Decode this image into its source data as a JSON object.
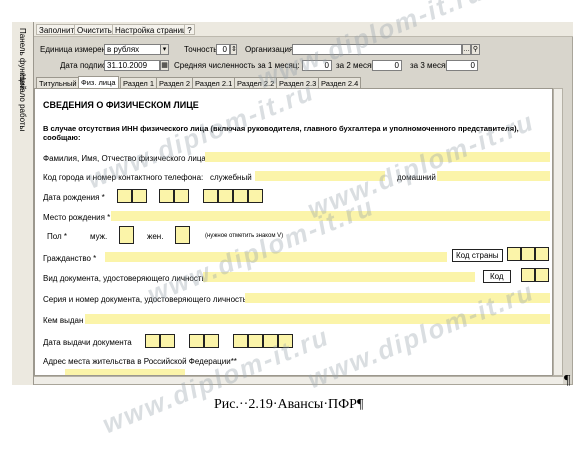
{
  "vertical_tabs": [
    "Панель функций",
    "Начало работы"
  ],
  "toolbar": {
    "fill_label": "Заполнить",
    "clear_label": "Очистить",
    "page_setup_label": "Настройка страниц",
    "help_label": "?"
  },
  "params": {
    "unit_label": "Единица измерения:",
    "unit_value": "в рублях",
    "precision_label": "Точность:",
    "precision_value": "0",
    "org_label": "Организация:",
    "org_value": "",
    "date_label": "Дата подписи:",
    "date_value": "31.10.2009",
    "headcount_label": "Средняя численность за 1 месяц:",
    "m1_value": "0",
    "m2_label": "за 2 месяц:",
    "m2_value": "0",
    "m3_label": "за 3 месяц:",
    "m3_value": "0"
  },
  "tabs": [
    "Титульный",
    "Физ. лица",
    "Раздел 1",
    "Раздел 2",
    "Раздел 2.1",
    "Раздел 2.2",
    "Раздел 2.3",
    "Раздел 2.4"
  ],
  "active_tab": "Физ. лица",
  "form": {
    "title": "СВЕДЕНИЯ О ФИЗИЧЕСКОМ ЛИЦЕ",
    "intro_line1": "В случае отсутствия ИНН физического лица (включая руководителя, главного бухгалтера и уполномоченного представителя),",
    "intro_line2": "сообщаю:",
    "fio": "Фамилия, Имя, Отчество физического лица",
    "phone": "Код города и номер контактного телефона:",
    "phone_work": "служебный",
    "phone_home": "домашний",
    "birth_date": "Дата рождения *",
    "birth_place": "Место рождения *",
    "sex": "Пол *",
    "male": "муж.",
    "female": "жен.",
    "sex_note": "(нужное отметить знаком V)",
    "citizenship": "Гражданство *",
    "country_code": "Код страны",
    "doc_type": "Вид документа, удостоверяющего личность",
    "code": "Код",
    "doc_number": "Серия и номер документа, удостоверяющего личность",
    "issued_by": "Кем выдан",
    "issue_date": "Дата выдачи документа",
    "address": "Адрес места жительства в Российской Федерации**"
  },
  "caption": "Рис.··2.19·Авансы·ПФР¶",
  "pilcrow": "¶",
  "watermark": "www.diplom-it.ru",
  "colors": {
    "field_yellow": "#fbf4a9",
    "window_bg": "#d8d5cc"
  }
}
